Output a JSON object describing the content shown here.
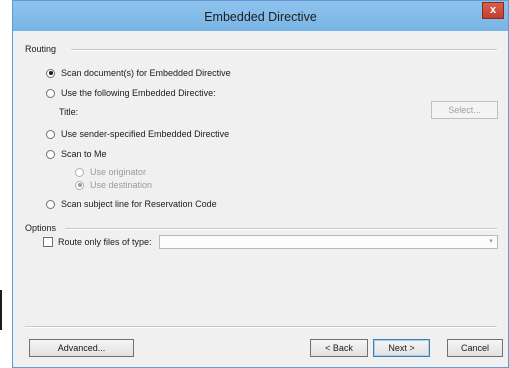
{
  "window": {
    "title": "Embedded Directive",
    "close_glyph": "x"
  },
  "routing": {
    "label": "Routing",
    "options": [
      {
        "label": "Scan document(s) for Embedded Directive",
        "checked": true
      },
      {
        "label": "Use the following Embedded Directive:",
        "checked": false
      },
      {
        "label": "Use sender-specified Embedded Directive",
        "checked": false
      },
      {
        "label": "Scan to Me",
        "checked": false
      },
      {
        "label": "Scan subject line for Reservation Code",
        "checked": false
      }
    ],
    "title_label": "Title:",
    "select_button": "Select...",
    "scan_to_me_sub": [
      {
        "label": "Use originator",
        "checked": false,
        "disabled": true
      },
      {
        "label": "Use destination",
        "checked": true,
        "disabled": true
      }
    ]
  },
  "options": {
    "label": "Options",
    "route_only_label": "Route only files of type:",
    "route_only_checked": false,
    "file_type_value": ""
  },
  "footer": {
    "advanced": "Advanced...",
    "back": "< Back",
    "next": "Next >",
    "cancel": "Cancel"
  },
  "icons": {
    "close": "close-icon",
    "dropdown": "chevron-down-icon"
  }
}
